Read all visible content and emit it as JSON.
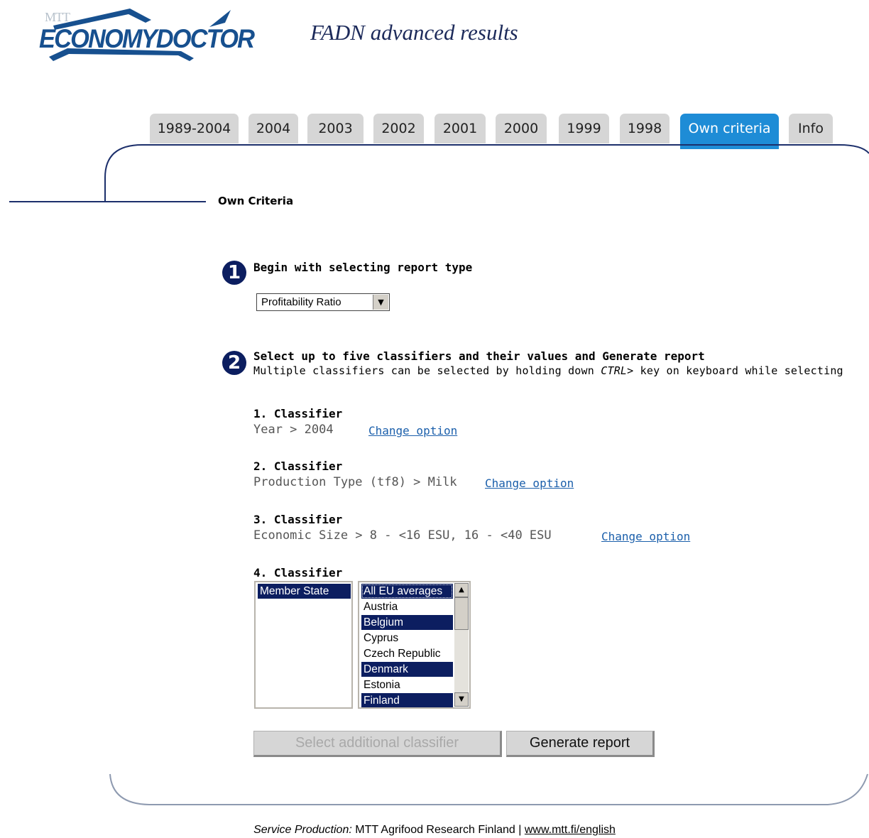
{
  "logo": {
    "org": "MTT",
    "word": "ECONOMYDOCTOR"
  },
  "site_title": "FADN advanced results",
  "tabs": [
    {
      "label": "1989-2004",
      "active": false
    },
    {
      "label": "2004",
      "active": false
    },
    {
      "label": "2003",
      "active": false
    },
    {
      "label": "2002",
      "active": false
    },
    {
      "label": "2001",
      "active": false
    },
    {
      "label": "2000",
      "active": false
    },
    {
      "label": "1999",
      "active": false
    },
    {
      "label": "1998",
      "active": false
    },
    {
      "label": "Own criteria",
      "active": true
    },
    {
      "label": "Info",
      "active": false
    }
  ],
  "section_heading": "Own Criteria",
  "step1": {
    "number": "1",
    "title": "Begin with selecting report type",
    "report_type": "Profitability Ratio"
  },
  "step2": {
    "number": "2",
    "title": "Select up to five classifiers and their values and Generate report",
    "hint_pre": "Multiple classifiers can be selected by holding down ",
    "hint_key": "CTRL>",
    "hint_post": " key on keyboard while selecting"
  },
  "classifiers": [
    {
      "title": "1. Classifier",
      "value": "Year > 2004",
      "link": "Change option"
    },
    {
      "title": "2. Classifier",
      "value": "Production Type (tf8) > Milk",
      "link": "Change option"
    },
    {
      "title": "3. Classifier",
      "value": "Economic Size > 8 - <16 ESU, 16 - <40 ESU",
      "link": "Change option"
    },
    {
      "title": "4. Classifier"
    }
  ],
  "classifier_list": {
    "selected": "Member State"
  },
  "values_list": [
    {
      "label": "All EU averages",
      "selected": true
    },
    {
      "label": "Austria",
      "selected": false
    },
    {
      "label": "Belgium",
      "selected": true
    },
    {
      "label": "Cyprus",
      "selected": false
    },
    {
      "label": "Czech Republic",
      "selected": false
    },
    {
      "label": "Denmark",
      "selected": true
    },
    {
      "label": "Estonia",
      "selected": false
    },
    {
      "label": "Finland",
      "selected": true
    }
  ],
  "buttons": {
    "add_classifier": "Select additional classifier",
    "generate": "Generate report"
  },
  "footer": {
    "label": "Service Production:",
    "text": " MTT Agrifood Research Finland | ",
    "link": "www.mtt.fi/english"
  },
  "colors": {
    "tab_active": "#1e8cd6",
    "tab_inactive": "#d6d6d6",
    "frame_line": "#1c2f6b",
    "selection": "#0c1e60",
    "link": "#1b5fab"
  }
}
